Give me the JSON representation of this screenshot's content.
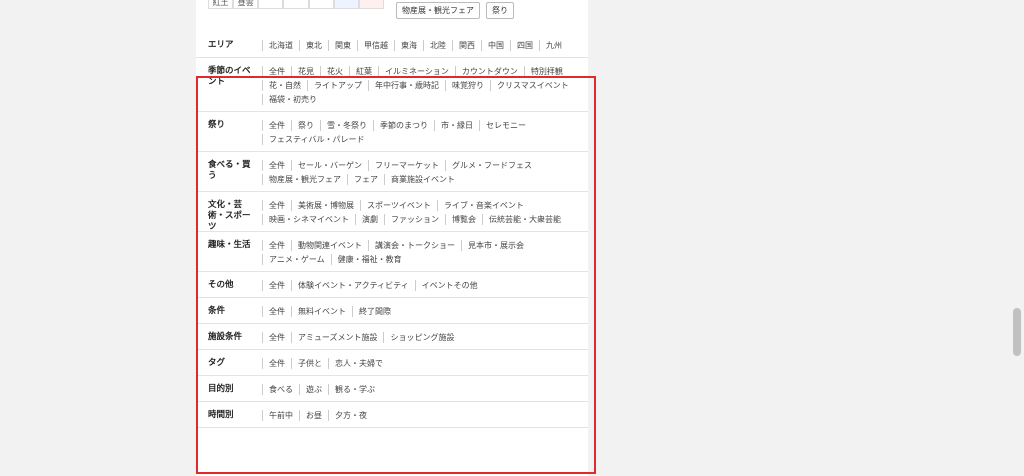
{
  "top_strip": {
    "cells": [
      "紅土",
      "昼雲",
      "",
      "",
      "",
      "",
      ""
    ],
    "tags": [
      "物産展・観光フェア",
      "祭り"
    ]
  },
  "rows": [
    {
      "label": "エリア",
      "items": [
        "北海道",
        "東北",
        "関東",
        "甲信越",
        "東海",
        "北陸",
        "関西",
        "中国",
        "四国",
        "九州"
      ]
    },
    {
      "label": "季節のイベント",
      "items": [
        "全件",
        "花見",
        "花火",
        "紅葉",
        "イルミネーション",
        "カウントダウン",
        "特別拝観",
        "花・自然",
        "ライトアップ",
        "年中行事・歳時記",
        "味覚狩り",
        "クリスマスイベント",
        "福袋・初売り"
      ]
    },
    {
      "label": "祭り",
      "items": [
        "全件",
        "祭り",
        "雪・冬祭り",
        "季節のまつり",
        "市・縁日",
        "セレモニー",
        "フェスティバル・パレード"
      ]
    },
    {
      "label": "食べる・買う",
      "items": [
        "全件",
        "セール・バーゲン",
        "フリーマーケット",
        "グルメ・フードフェス",
        "物産展・観光フェア",
        "フェア",
        "商業施設イベント"
      ]
    },
    {
      "label": "文化・芸術・スポーツ",
      "items": [
        "全件",
        "美術展・博物展",
        "スポーツイベント",
        "ライブ・音楽イベント",
        "映画・シネマイベント",
        "演劇",
        "ファッション",
        "博覧会",
        "伝統芸能・大衆芸能"
      ]
    },
    {
      "label": "趣味・生活",
      "items": [
        "全件",
        "動物関連イベント",
        "講演会・トークショー",
        "見本市・展示会",
        "アニメ・ゲーム",
        "健康・福祉・教育"
      ]
    },
    {
      "label": "その他",
      "items": [
        "全件",
        "体験イベント・アクティビティ",
        "イベントその他"
      ]
    },
    {
      "label": "条件",
      "items": [
        "全件",
        "無料イベント",
        "終了間際"
      ]
    },
    {
      "label": "施設条件",
      "items": [
        "全件",
        "アミューズメント施設",
        "ショッピング施設"
      ]
    },
    {
      "label": "タグ",
      "items": [
        "全件",
        "子供と",
        "恋人・夫婦で"
      ]
    },
    {
      "label": "目的別",
      "items": [
        "食べる",
        "遊ぶ",
        "観る・学ぶ"
      ]
    },
    {
      "label": "時間別",
      "items": [
        "午前中",
        "お昼",
        "夕方・夜"
      ]
    }
  ]
}
